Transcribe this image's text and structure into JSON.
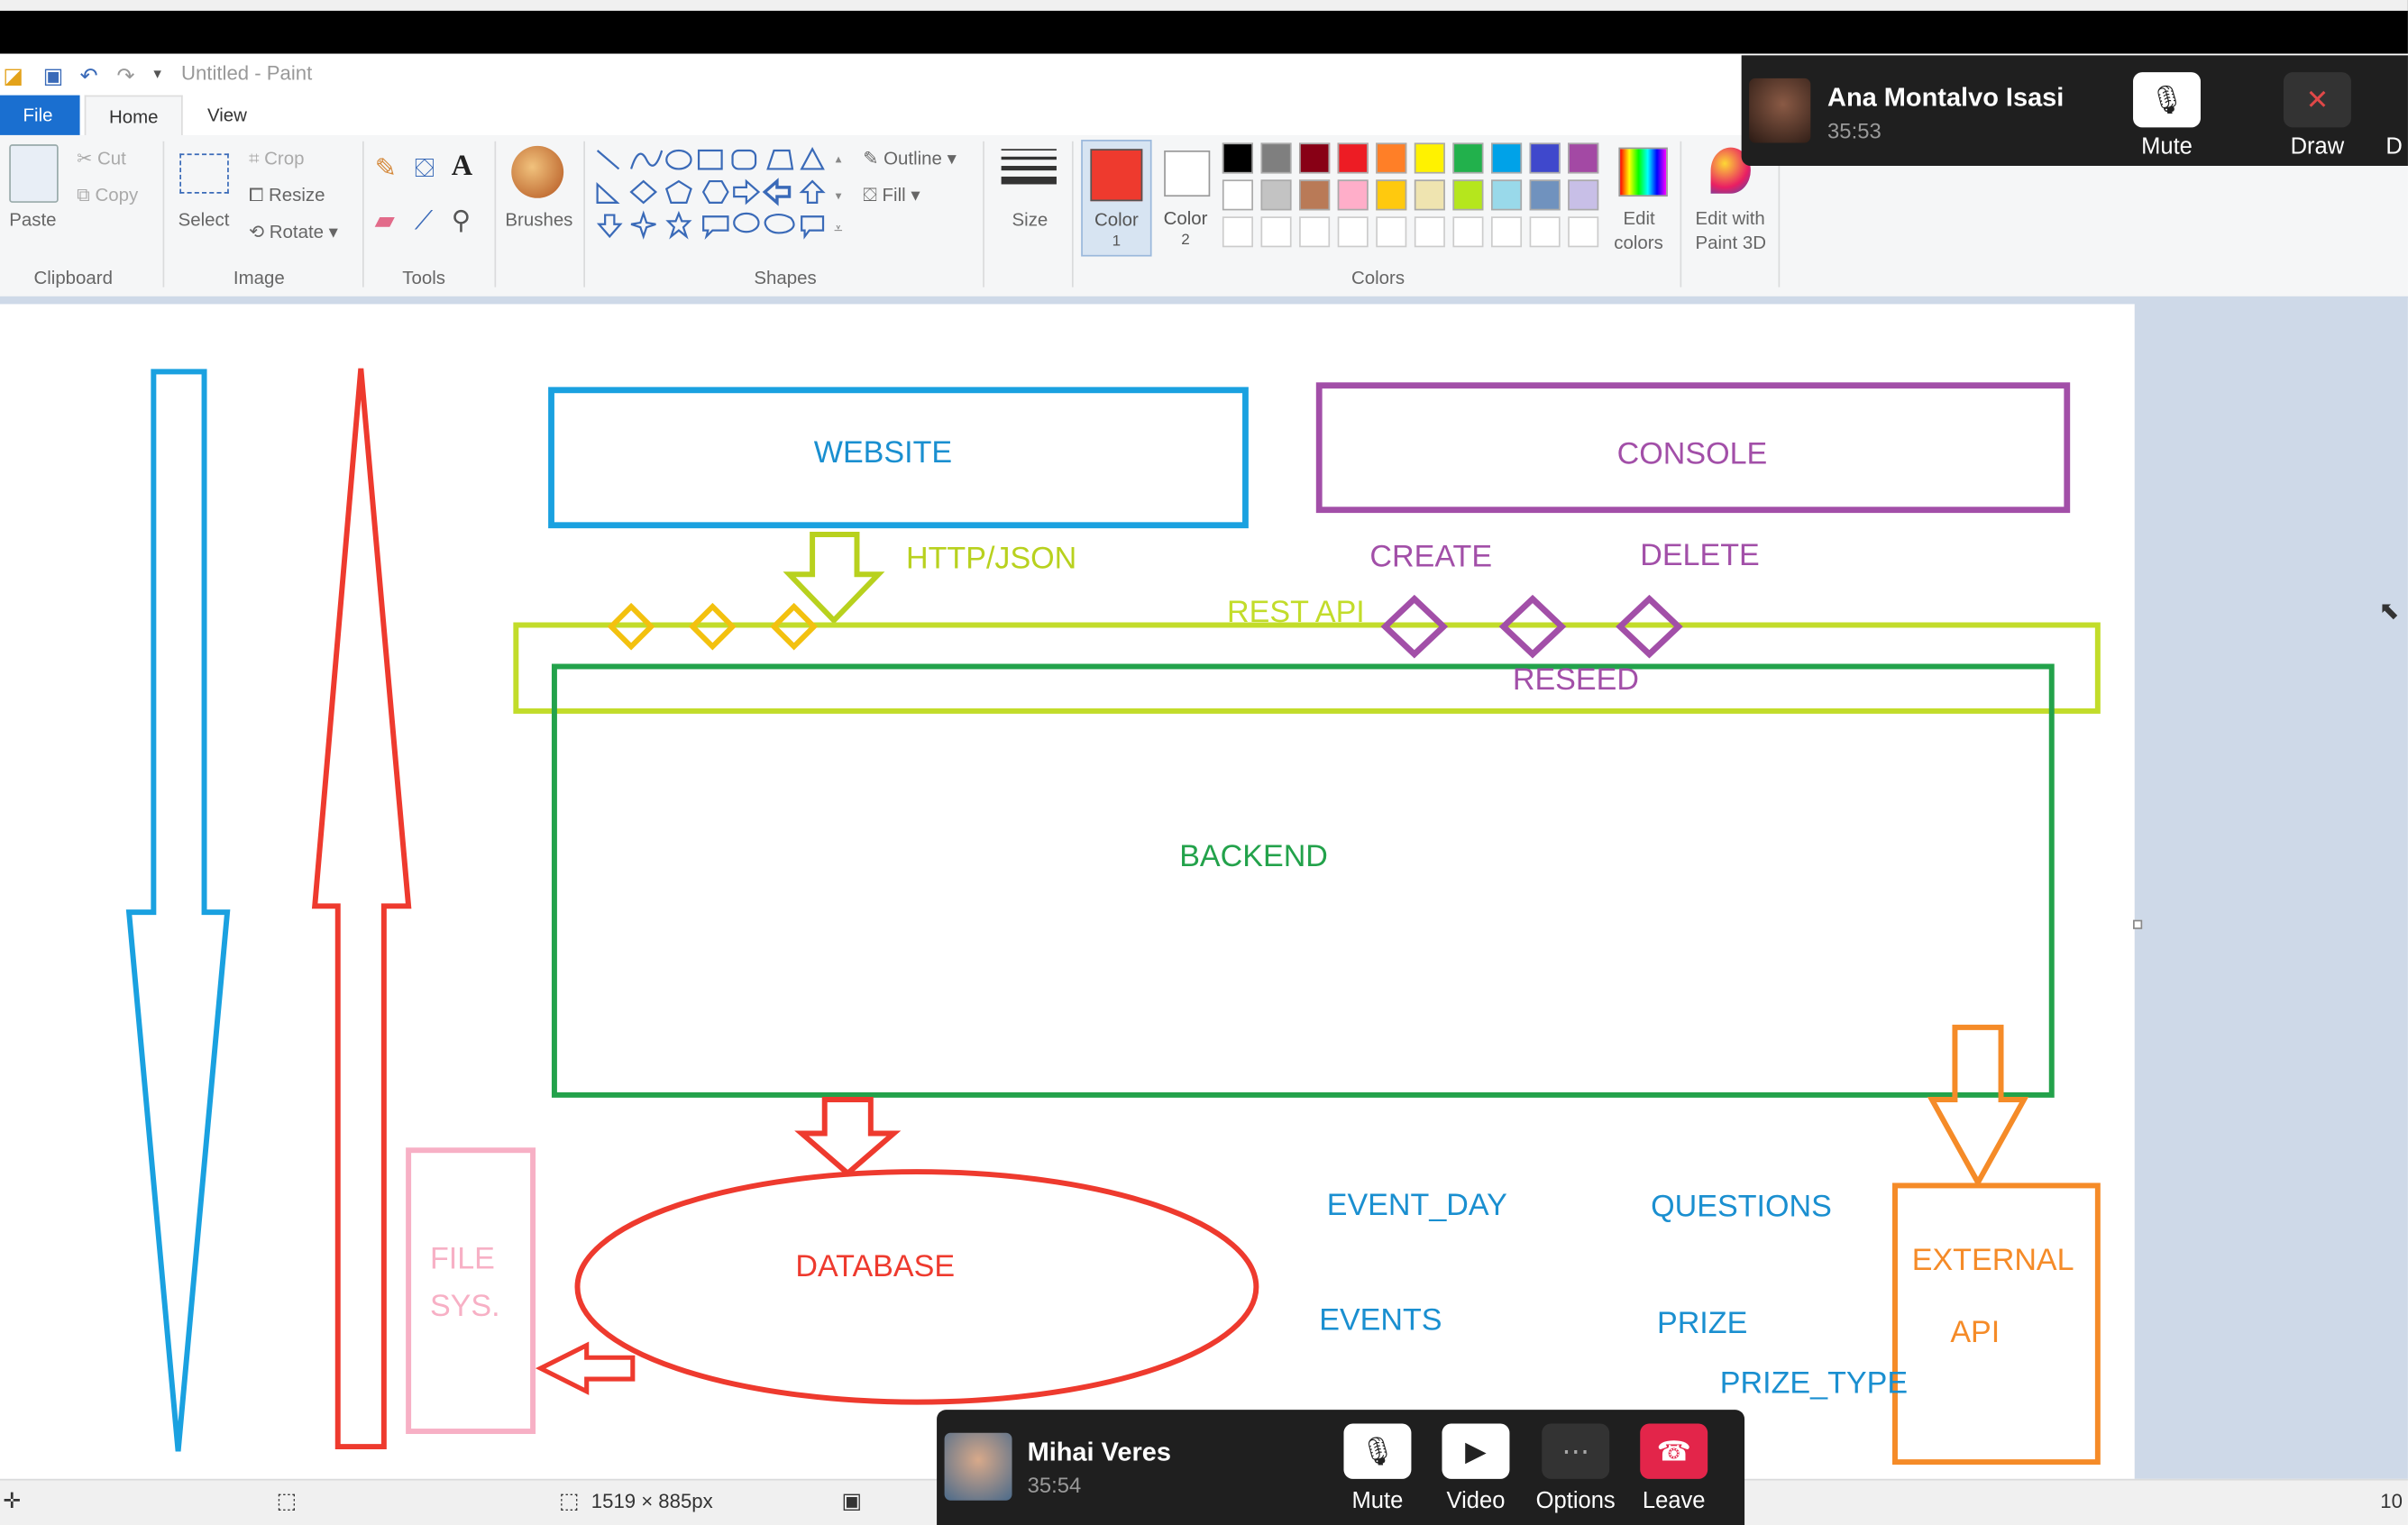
{
  "app": {
    "title": "Untitled - Paint",
    "menu": {
      "file": "File",
      "home": "Home",
      "view": "View"
    }
  },
  "ribbon": {
    "clipboard": {
      "paste": "Paste",
      "cut": "Cut",
      "copy": "Copy",
      "group": "Clipboard"
    },
    "image": {
      "select": "Select",
      "crop": "Crop",
      "resize": "Resize",
      "rotate": "Rotate",
      "group": "Image"
    },
    "tools": {
      "group": "Tools"
    },
    "brushes": {
      "label": "Brushes"
    },
    "shapes": {
      "outline": "Outline",
      "fill": "Fill",
      "group": "Shapes"
    },
    "size": {
      "label": "Size"
    },
    "color1": {
      "label": "Color",
      "num": "1",
      "value": "#ee3a2e"
    },
    "color2": {
      "label": "Color",
      "num": "2",
      "value": "#ffffff"
    },
    "colors": {
      "group": "Colors",
      "row1": [
        "#000000",
        "#7f7f7f",
        "#880015",
        "#ed1c24",
        "#ff7f27",
        "#fff200",
        "#22b14c",
        "#00a2e8",
        "#3f48cc",
        "#a349a4"
      ],
      "row2": [
        "#ffffff",
        "#c3c3c3",
        "#b97a57",
        "#ffaec9",
        "#ffc90e",
        "#efe4b0",
        "#b5e61d",
        "#99d9ea",
        "#7092be",
        "#c8bfe7"
      ]
    },
    "edit_colors": {
      "line1": "Edit",
      "line2": "colors"
    },
    "paint3d": {
      "line1": "Edit with",
      "line2": "Paint 3D"
    }
  },
  "diagram": {
    "website": "WEBSITE",
    "console": "CONSOLE",
    "http_json": "HTTP/JSON",
    "create": "CREATE",
    "delete": "DELETE",
    "rest_api": "REST API",
    "reseed": "RESEED",
    "backend": "BACKEND",
    "database": "DATABASE",
    "file_sys_1": "FILE",
    "file_sys_2": "SYS.",
    "event_day": "EVENT_DAY",
    "questions": "QUESTIONS",
    "events": "EVENTS",
    "prize": "PRIZE",
    "prize_type": "PRIZE_TYPE",
    "external_1": "EXTERNAL",
    "external_2": "API"
  },
  "status": {
    "dimensions": "1519 × 885px",
    "zoom": "10"
  },
  "call_top": {
    "name": "Ana Montalvo Isasi",
    "time": "35:53",
    "mute": "Mute",
    "draw": "Draw",
    "more": "D"
  },
  "call_bottom": {
    "name": "Mihai Veres",
    "time": "35:54",
    "mute": "Mute",
    "video": "Video",
    "options": "Options",
    "leave": "Leave"
  }
}
